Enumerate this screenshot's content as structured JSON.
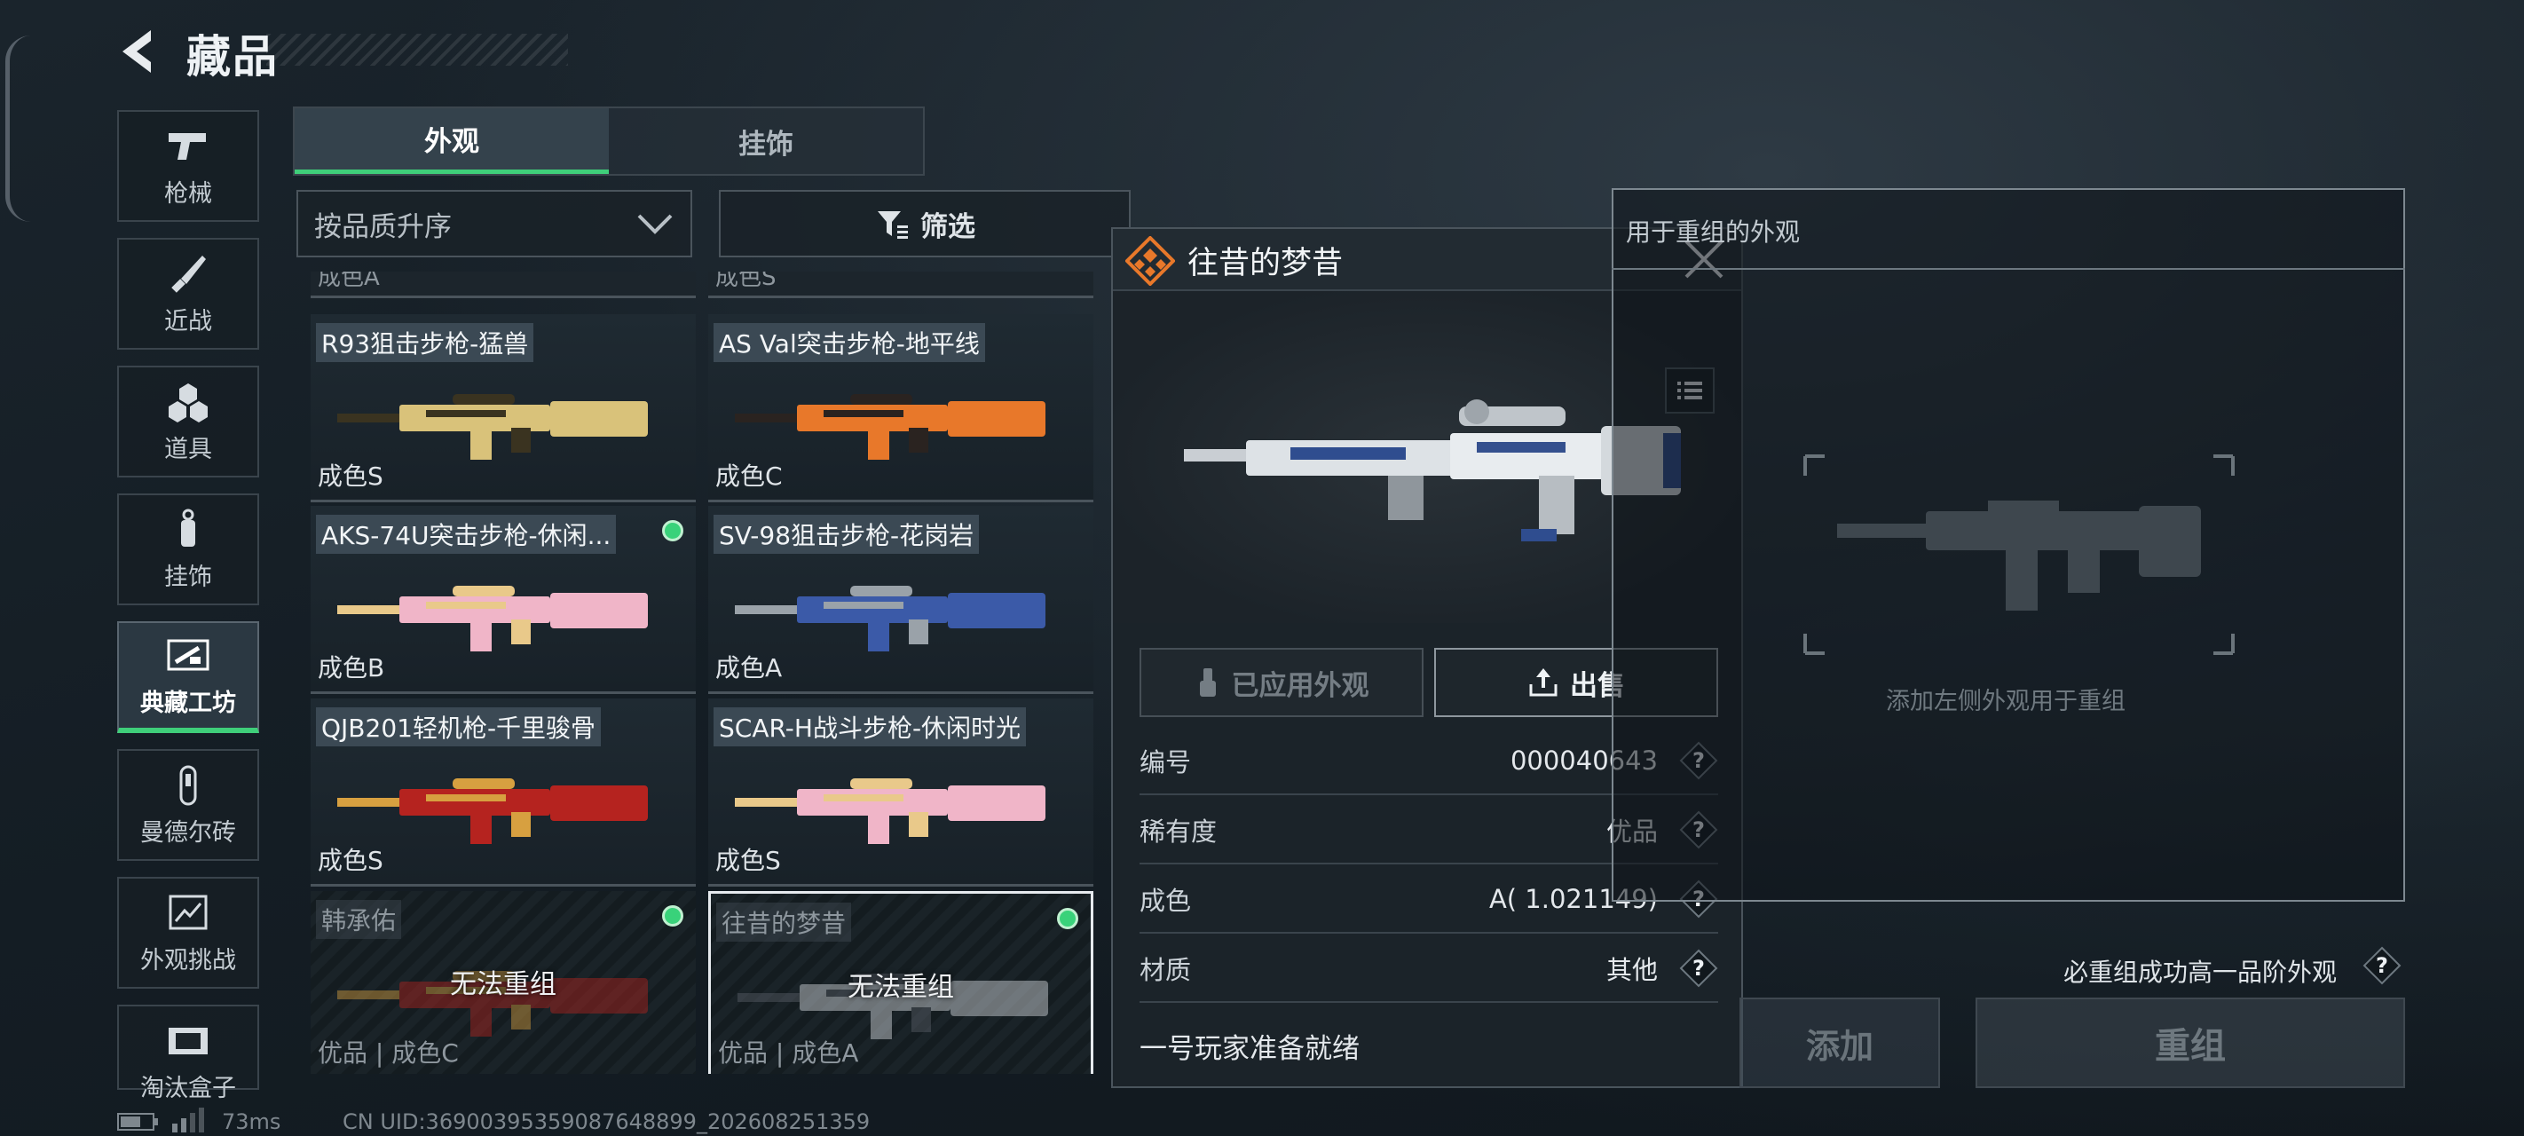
{
  "header": {
    "title": "藏品"
  },
  "nav": [
    {
      "label": "枪械",
      "icon": "pistol-icon"
    },
    {
      "label": "近战",
      "icon": "knife-icon"
    },
    {
      "label": "道具",
      "icon": "hexagon-cluster-icon"
    },
    {
      "label": "挂饰",
      "icon": "charm-icon"
    },
    {
      "label": "典藏工坊",
      "icon": "workshop-icon",
      "active": true
    },
    {
      "label": "曼德尔砖",
      "icon": "brick-icon"
    },
    {
      "label": "外观挑战",
      "icon": "challenge-icon"
    },
    {
      "label": "淘汰盒子",
      "icon": "box-icon"
    }
  ],
  "tabs": [
    {
      "label": "外观",
      "active": true
    },
    {
      "label": "挂饰",
      "active": false
    }
  ],
  "sort": {
    "label": "按品质升序"
  },
  "filter": {
    "label": "筛选"
  },
  "top_partial": [
    "成色A",
    "成色S"
  ],
  "cards": [
    {
      "name": "R93狙击步枪-猛兽",
      "grade": "成色S",
      "equipped": false,
      "locked": false,
      "skin": "gold"
    },
    {
      "name": "AS Val突击步枪-地平线",
      "grade": "成色C",
      "equipped": false,
      "locked": false,
      "skin": "orange"
    },
    {
      "name": "AKS-74U突击步枪-休闲...",
      "grade": "成色B",
      "equipped": true,
      "locked": false,
      "skin": "pink"
    },
    {
      "name": "SV-98狙击步枪-花岗岩",
      "grade": "成色A",
      "equipped": false,
      "locked": false,
      "skin": "blue"
    },
    {
      "name": "QJB201轻机枪-千里骏骨",
      "grade": "成色S",
      "equipped": false,
      "locked": false,
      "skin": "red"
    },
    {
      "name": "SCAR-H战斗步枪-休闲时光",
      "grade": "成色S",
      "equipped": false,
      "locked": false,
      "skin": "pink"
    },
    {
      "name": "韩承佑",
      "grade": "优品 | 成色C",
      "equipped": true,
      "locked": true,
      "locked_text": "无法重组",
      "skin": "red"
    },
    {
      "name": "往昔的梦昔",
      "grade": "优品 | 成色A",
      "equipped": true,
      "locked": true,
      "locked_text": "无法重组",
      "skin": "white",
      "selected": true
    }
  ],
  "popup": {
    "title": "往昔的梦昔",
    "applied_label": "已应用外观",
    "sell_label": "出售",
    "props": [
      {
        "key": "编号",
        "value": "000040643"
      },
      {
        "key": "稀有度",
        "value": "优品"
      },
      {
        "key": "成色",
        "value": "A( 1.021149)"
      },
      {
        "key": "材质",
        "value": "其他"
      }
    ],
    "status": "一号玩家准备就绪"
  },
  "recombine": {
    "title": "用于重组的外观",
    "hint": "添加左侧外观用于重组",
    "must_text": "必重组成功高一品阶外观",
    "add_label": "添加",
    "recombine_label": "重组"
  },
  "footer": {
    "ping": "73ms",
    "uid": "CN UID:369003953590876488​99_202608251359"
  },
  "colors": {
    "accent": "#3fcf7a",
    "orange": "#e8782a"
  }
}
